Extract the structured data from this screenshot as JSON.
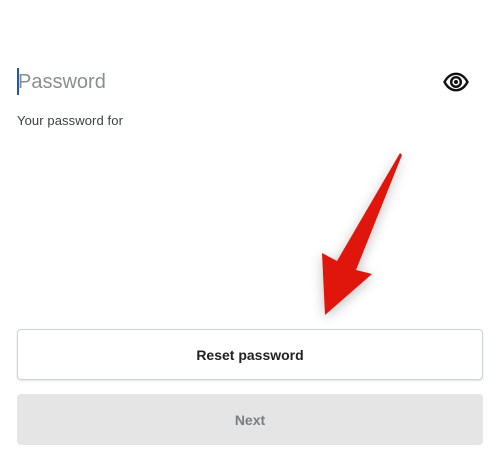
{
  "password_field": {
    "placeholder": "Password",
    "value": "",
    "toggle_icon": "eye-icon"
  },
  "helper_text": "Your password for",
  "buttons": {
    "reset_label": "Reset password",
    "next_label": "Next"
  },
  "annotation": {
    "arrow_color": "#e0140f",
    "icon": "arrow-pointer"
  }
}
